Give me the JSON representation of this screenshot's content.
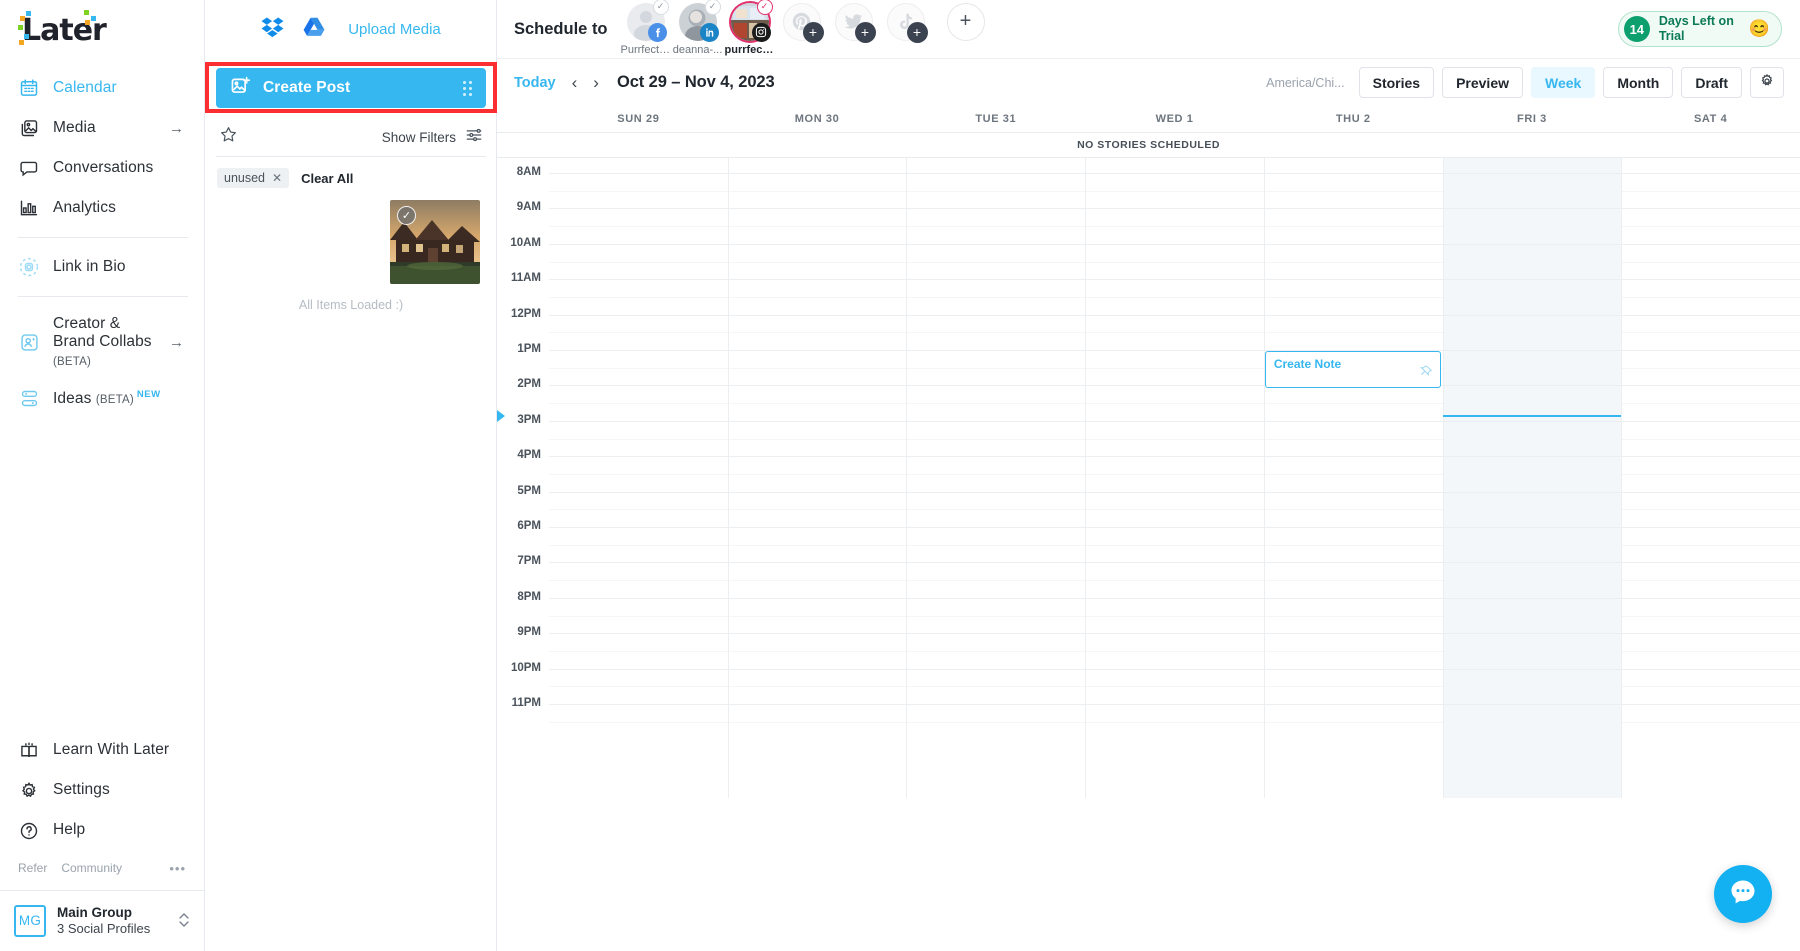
{
  "brand": {
    "name": "Later",
    "accent": "#37b7f0",
    "highlight": "#fb2f31"
  },
  "sidebar": {
    "items": [
      {
        "label": "Calendar",
        "icon": "calendar-icon",
        "active": true,
        "arrow": ""
      },
      {
        "label": "Media",
        "icon": "media-icon",
        "active": false,
        "arrow": "→"
      },
      {
        "label": "Conversations",
        "icon": "conversations-icon",
        "active": false,
        "arrow": ""
      },
      {
        "label": "Analytics",
        "icon": "analytics-icon",
        "active": false,
        "arrow": ""
      },
      {
        "label": "Link in Bio",
        "icon": "link-in-bio-icon",
        "active": false,
        "arrow": ""
      },
      {
        "label": "Creator & Brand Collabs",
        "sub": "(BETA)",
        "icon": "collabs-icon",
        "active": false,
        "arrow": "→"
      },
      {
        "label": "Ideas",
        "sub": "(BETA)",
        "badge": "NEW",
        "icon": "ideas-icon",
        "active": false,
        "arrow": ""
      }
    ],
    "footer_items": [
      {
        "label": "Learn With Later",
        "icon": "book-icon"
      },
      {
        "label": "Settings",
        "icon": "gear-icon"
      },
      {
        "label": "Help",
        "icon": "help-icon"
      }
    ],
    "mini_links": {
      "refer": "Refer",
      "community": "Community",
      "more": "•••"
    },
    "account": {
      "initials": "MG",
      "name": "Main Group",
      "sub": "3 Social Profiles"
    }
  },
  "media_panel": {
    "dropbox_icon": "dropbox-icon",
    "gdrive_icon": "google-drive-icon",
    "upload_label": "Upload Media",
    "create_post_label": "Create Post",
    "star_icon": "star-icon",
    "show_filters_label": "Show Filters",
    "filters_icon": "filters-icon",
    "tag": "unused",
    "tag_remove": "✕",
    "clear_all_label": "Clear All",
    "all_loaded_label": "All Items Loaded :)"
  },
  "header": {
    "schedule_to_label": "Schedule to",
    "profiles": [
      {
        "name": "Purrfect ...",
        "network": "facebook",
        "checked": true,
        "selected": false
      },
      {
        "name": "deanna-...",
        "network": "linkedin",
        "checked": true,
        "selected": false
      },
      {
        "name": "purrfect...",
        "network": "instagram",
        "checked": true,
        "selected": true
      },
      {
        "name": "",
        "network": "pinterest",
        "add": true
      },
      {
        "name": "",
        "network": "twitter",
        "add": true
      },
      {
        "name": "",
        "network": "tiktok",
        "add": true
      },
      {
        "name": "",
        "network": "plus",
        "plain_add": true
      }
    ],
    "trial": {
      "days": "14",
      "line1": "Days Left on",
      "line2": "Trial",
      "emoji": "😊",
      "color": "#0e9f6e"
    }
  },
  "toolbar": {
    "today_label": "Today",
    "prev_icon": "chevron-left-icon",
    "next_icon": "chevron-right-icon",
    "date_range": "Oct 29 – Nov 4, 2023",
    "timezone": "America/Chi...",
    "buttons": [
      {
        "label": "Stories",
        "selected": false
      },
      {
        "label": "Preview",
        "selected": false
      },
      {
        "label": "Week",
        "selected": true
      },
      {
        "label": "Month",
        "selected": false
      },
      {
        "label": "Draft",
        "selected": false
      }
    ],
    "settings_icon": "gear-icon"
  },
  "calendar": {
    "days": [
      "SUN 29",
      "MON 30",
      "TUE 31",
      "WED 1",
      "THU 2",
      "FRI 3",
      "SAT 4"
    ],
    "stories_row_label": "NO STORIES SCHEDULED",
    "times": [
      "8AM",
      "9AM",
      "10AM",
      "11AM",
      "12PM",
      "1PM",
      "2PM",
      "3PM",
      "4PM",
      "5PM",
      "6PM",
      "7PM",
      "8PM",
      "9PM",
      "10PM",
      "11PM"
    ],
    "today_column_index": 5,
    "now_indicator_time": "2:45PM",
    "events": [
      {
        "title": "Create Note",
        "day_index": 4,
        "time": "1PM",
        "pin_icon": "pin-icon"
      }
    ]
  },
  "chat": {
    "icon": "chat-bubble-icon",
    "color": "#13b0f2"
  }
}
